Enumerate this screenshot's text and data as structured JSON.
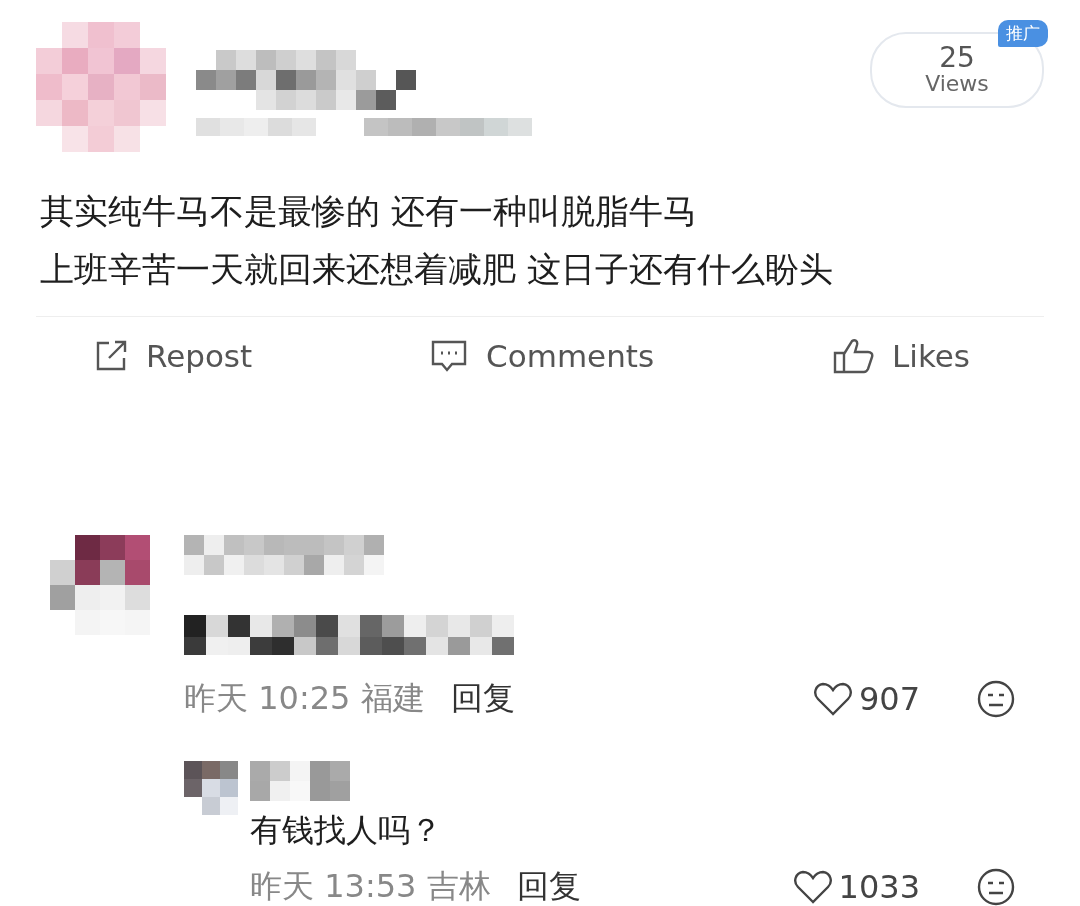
{
  "post": {
    "views": {
      "count": "25",
      "label": "Views",
      "tag": "推广"
    },
    "lines": [
      "其实纯牛马不是最惨的 还有一种叫脱脂牛马",
      "上班辛苦一天就回来还想着减肥 这日子还有什么盼头"
    ]
  },
  "actions": [
    {
      "kind": "repost",
      "label": "Repost"
    },
    {
      "kind": "comments",
      "label": "Comments"
    },
    {
      "kind": "likes",
      "label": "Likes"
    }
  ],
  "comments": [
    {
      "meta": "昨天 10:25 福建",
      "reply": "回复",
      "likes": "907",
      "children": [
        {
          "text": "有钱找人吗？",
          "meta": "昨天 13:53 吉林",
          "reply": "回复",
          "likes": "1033"
        }
      ]
    }
  ]
}
